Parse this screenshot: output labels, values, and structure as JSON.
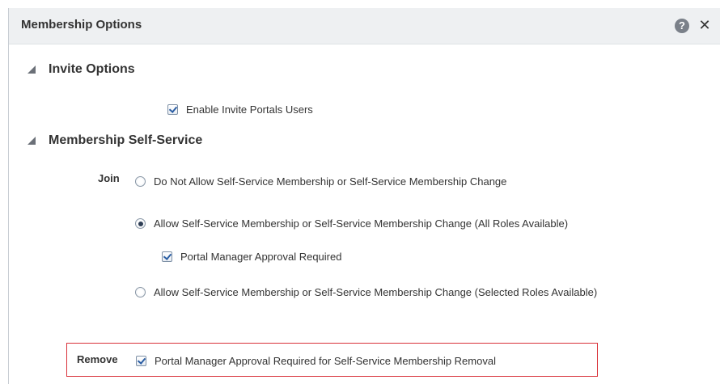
{
  "dialog": {
    "title": "Membership Options",
    "help_symbol": "?",
    "close_symbol": "✕"
  },
  "invite_options": {
    "title": "Invite Options",
    "enable_invite": {
      "label": "Enable Invite Portals Users",
      "checked": true
    }
  },
  "self_service": {
    "title": "Membership Self-Service",
    "join_label": "Join",
    "options": [
      {
        "label": "Do Not Allow Self-Service Membership or Self-Service Membership Change",
        "selected": false
      },
      {
        "label": "Allow Self-Service Membership or Self-Service Membership Change (All Roles Available)",
        "selected": true
      },
      {
        "label": "Allow Self-Service Membership or Self-Service Membership Change (Selected Roles Available)",
        "selected": false
      }
    ],
    "manager_approval": {
      "label": "Portal Manager Approval Required",
      "checked": true
    },
    "remove_label": "Remove",
    "removal_approval": {
      "label": "Portal Manager Approval Required for Self-Service Membership Removal",
      "checked": true
    }
  },
  "colors": {
    "header_bg": "#eef0f2",
    "highlight_border": "#d9323a",
    "icon_gray": "#7a8089"
  }
}
